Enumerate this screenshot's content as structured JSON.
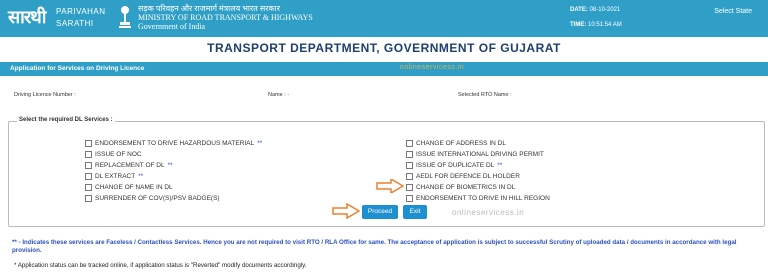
{
  "header": {
    "logo_hindi": "सारथी",
    "logo_line1": "PARIVAHAN",
    "logo_line2": "SARATHI",
    "ministry_hindi": "सड़क परिवहन और राजमार्ग मंत्रालय भारत सरकार",
    "ministry_english": "MINISTRY OF ROAD TRANSPORT & HIGHWAYS",
    "government": "Government of India",
    "date_label": "DATE:",
    "date_value": "08-10-2021",
    "time_label": "TIME:",
    "time_value": "10:51:54 AM",
    "select_state": "Select State"
  },
  "department_title": "TRANSPORT DEPARTMENT, GOVERNMENT OF GUJARAT",
  "section_bar": {
    "label": "Application for Services on Driving Licence",
    "watermark": "onlineservicess.in"
  },
  "fields": {
    "dl_number": "Driving Licence Number :",
    "name": "Name : -",
    "rto_name": "Selected RTO Name :"
  },
  "services_legend": "Select the required DL Services :",
  "services_left": [
    {
      "label": "ENDORSEMENT TO DRIVE HAZARDOUS MATERIAL",
      "star": "**"
    },
    {
      "label": "ISSUE OF NOC",
      "star": ""
    },
    {
      "label": "REPLACEMENT OF DL",
      "star": "**"
    },
    {
      "label": "DL EXTRACT",
      "star": "**"
    },
    {
      "label": "CHANGE OF NAME IN DL",
      "star": ""
    },
    {
      "label": "SURRENDER OF COV(S)/PSV BADGE(S)",
      "star": ""
    }
  ],
  "services_right": [
    {
      "label": "CHANGE OF ADDRESS IN DL",
      "star": ""
    },
    {
      "label": "ISSUE INTERNATIONAL DRIVING PERMIT",
      "star": ""
    },
    {
      "label": "ISSUE OF DUPLICATE DL",
      "star": "**"
    },
    {
      "label": "AEDL FOR DEFENCE DL HOLDER",
      "star": ""
    },
    {
      "label": "CHANGE OF BIOMETRICS IN DL",
      "star": ""
    },
    {
      "label": "ENDORSEMENT TO DRIVE IN HILL REGION",
      "star": ""
    }
  ],
  "buttons": {
    "proceed": "Proceed",
    "exit": "Exit"
  },
  "watermark2": "onlineservicess.in",
  "notes": {
    "faceless": "** - Indicates these services are Faceless / Contactless Services. Hence you are not required to visit RTO / RLA Office for same. The acceptance of application is subject to successful Scrutiny of uploaded data / documents in accordance with legal provision.",
    "status": "* Application status can be tracked online, if application status is \"Reverted\" modify documents accordingly."
  },
  "colors": {
    "header_blue": "#2f9fc8",
    "button_blue": "#1e8fd0",
    "arrow_orange": "#f07f2c",
    "note_blue": "#2b50c4"
  }
}
